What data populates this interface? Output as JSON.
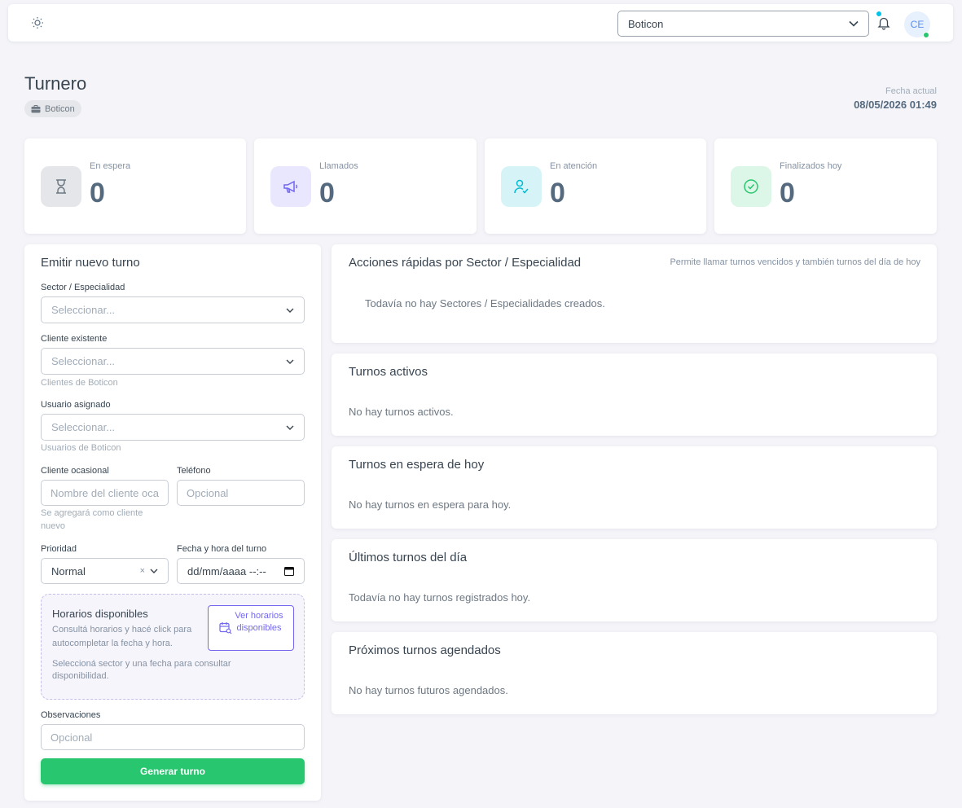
{
  "topbar": {
    "company_selected": "Boticon",
    "avatar_initials": "CE"
  },
  "header": {
    "title": "Turnero",
    "company_badge": "Boticon",
    "date_label": "Fecha actual",
    "date_value": "08/05/2026 01:49"
  },
  "stats": [
    {
      "label": "En espera",
      "value": "0",
      "icon": "hourglass-icon",
      "color": "#8592a3"
    },
    {
      "label": "Llamados",
      "value": "0",
      "icon": "megaphone-icon",
      "color": "#7367f0"
    },
    {
      "label": "En atención",
      "value": "0",
      "icon": "user-check-icon",
      "color": "#00bad1"
    },
    {
      "label": "Finalizados hoy",
      "value": "0",
      "icon": "check-circle-icon",
      "color": "#28c76f"
    }
  ],
  "form": {
    "title": "Emitir nuevo turno",
    "sector_label": "Sector / Especialidad",
    "sector_value": "Seleccionar...",
    "cliente_label": "Cliente existente",
    "cliente_value": "Seleccionar...",
    "cliente_hint": "Clientes de Boticon",
    "usuario_label": "Usuario asignado",
    "usuario_value": "Seleccionar...",
    "usuario_hint": "Usuarios de Boticon",
    "ocasional_label": "Cliente ocasional",
    "ocasional_placeholder": "Nombre del cliente ocasional",
    "ocasional_hint": "Se agregará como cliente nuevo",
    "telefono_label": "Teléfono",
    "telefono_placeholder": "Opcional",
    "prioridad_label": "Prioridad",
    "prioridad_value": "Normal",
    "fecha_label": "Fecha y hora del turno",
    "fecha_value": "dd/mm/aaaa --:--",
    "horarios": {
      "title": "Horarios disponibles",
      "description": "Consultá horarios y hacé click para autocompletar la fecha y hora.",
      "button": "Ver horarios disponibles",
      "note": "Seleccioná sector y una fecha para consultar disponibilidad."
    },
    "observaciones_label": "Observaciones",
    "observaciones_placeholder": "Opcional",
    "submit": "Generar turno"
  },
  "sections": {
    "acciones": {
      "title": "Acciones rápidas por Sector / Especialidad",
      "note": "Permite llamar turnos vencidos y también turnos del día de hoy",
      "empty": "Todavía no hay Sectores / Especialidades creados."
    },
    "activos": {
      "title": "Turnos activos",
      "empty": "No hay turnos activos."
    },
    "espera": {
      "title": "Turnos en espera de hoy",
      "empty": "No hay turnos en espera para hoy."
    },
    "ultimos": {
      "title": "Últimos turnos del día",
      "empty": "Todavía no hay turnos registrados hoy."
    },
    "proximos": {
      "title": "Próximos turnos agendados",
      "empty": "No hay turnos futuros agendados."
    }
  }
}
